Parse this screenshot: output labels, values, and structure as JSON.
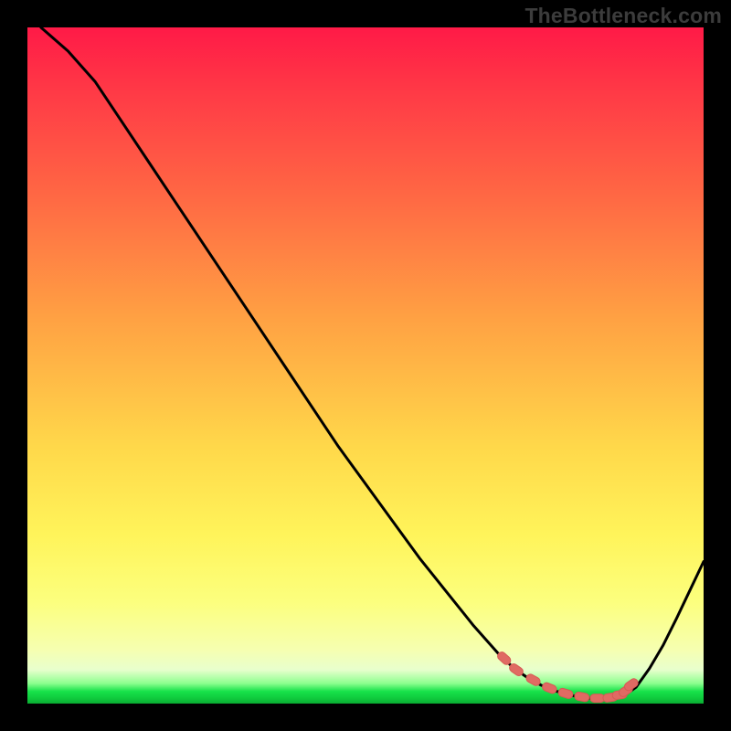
{
  "watermark": "TheBottleneck.com",
  "colors": {
    "frame": "#000000",
    "watermark_text": "#3c3c3c",
    "curve": "#000000",
    "marker_fill": "#e06a63",
    "marker_stroke": "#d65a54"
  },
  "chart_data": {
    "type": "line",
    "title": "",
    "xlabel": "",
    "ylabel": "",
    "xlim": [
      0,
      100
    ],
    "ylim": [
      0,
      100
    ],
    "grid": false,
    "legend": false,
    "series": [
      {
        "name": "bottleneck-curve",
        "x": [
          2,
          6,
          10,
          14,
          18,
          22,
          26,
          30,
          34,
          38,
          42,
          46,
          50,
          54,
          58,
          62,
          66,
          70,
          72,
          74,
          76,
          78,
          80,
          82,
          84,
          86,
          88,
          90,
          92,
          94,
          96,
          98,
          100
        ],
        "y": [
          100,
          96.5,
          92,
          86,
          80,
          74,
          68,
          62,
          56,
          50,
          44,
          38,
          32.5,
          27,
          21.5,
          16.5,
          11.5,
          7,
          5.2,
          3.8,
          2.7,
          1.9,
          1.3,
          0.9,
          0.7,
          0.7,
          1.0,
          2.4,
          5.2,
          8.6,
          12.6,
          16.8,
          21.0
        ]
      }
    ],
    "markers": {
      "name": "optimal-range",
      "x": [
        70.5,
        72.3,
        74.8,
        77.2,
        79.6,
        82.0,
        84.3,
        86.2,
        87.6,
        88.5,
        89.3
      ],
      "y": [
        6.7,
        5.0,
        3.5,
        2.3,
        1.5,
        1.0,
        0.8,
        0.9,
        1.3,
        1.9,
        2.8
      ]
    }
  }
}
